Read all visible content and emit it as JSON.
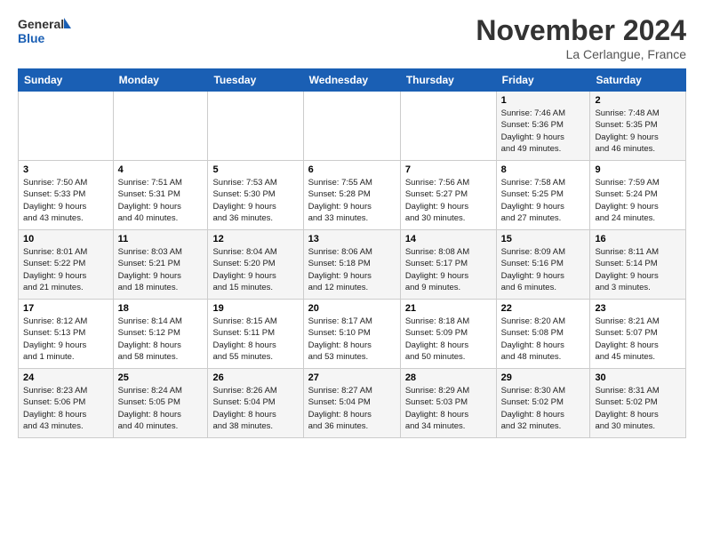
{
  "logo": {
    "line1": "General",
    "line2": "Blue"
  },
  "title": "November 2024",
  "location": "La Cerlangue, France",
  "weekdays": [
    "Sunday",
    "Monday",
    "Tuesday",
    "Wednesday",
    "Thursday",
    "Friday",
    "Saturday"
  ],
  "weeks": [
    [
      {
        "day": "",
        "info": ""
      },
      {
        "day": "",
        "info": ""
      },
      {
        "day": "",
        "info": ""
      },
      {
        "day": "",
        "info": ""
      },
      {
        "day": "",
        "info": ""
      },
      {
        "day": "1",
        "info": "Sunrise: 7:46 AM\nSunset: 5:36 PM\nDaylight: 9 hours\nand 49 minutes."
      },
      {
        "day": "2",
        "info": "Sunrise: 7:48 AM\nSunset: 5:35 PM\nDaylight: 9 hours\nand 46 minutes."
      }
    ],
    [
      {
        "day": "3",
        "info": "Sunrise: 7:50 AM\nSunset: 5:33 PM\nDaylight: 9 hours\nand 43 minutes."
      },
      {
        "day": "4",
        "info": "Sunrise: 7:51 AM\nSunset: 5:31 PM\nDaylight: 9 hours\nand 40 minutes."
      },
      {
        "day": "5",
        "info": "Sunrise: 7:53 AM\nSunset: 5:30 PM\nDaylight: 9 hours\nand 36 minutes."
      },
      {
        "day": "6",
        "info": "Sunrise: 7:55 AM\nSunset: 5:28 PM\nDaylight: 9 hours\nand 33 minutes."
      },
      {
        "day": "7",
        "info": "Sunrise: 7:56 AM\nSunset: 5:27 PM\nDaylight: 9 hours\nand 30 minutes."
      },
      {
        "day": "8",
        "info": "Sunrise: 7:58 AM\nSunset: 5:25 PM\nDaylight: 9 hours\nand 27 minutes."
      },
      {
        "day": "9",
        "info": "Sunrise: 7:59 AM\nSunset: 5:24 PM\nDaylight: 9 hours\nand 24 minutes."
      }
    ],
    [
      {
        "day": "10",
        "info": "Sunrise: 8:01 AM\nSunset: 5:22 PM\nDaylight: 9 hours\nand 21 minutes."
      },
      {
        "day": "11",
        "info": "Sunrise: 8:03 AM\nSunset: 5:21 PM\nDaylight: 9 hours\nand 18 minutes."
      },
      {
        "day": "12",
        "info": "Sunrise: 8:04 AM\nSunset: 5:20 PM\nDaylight: 9 hours\nand 15 minutes."
      },
      {
        "day": "13",
        "info": "Sunrise: 8:06 AM\nSunset: 5:18 PM\nDaylight: 9 hours\nand 12 minutes."
      },
      {
        "day": "14",
        "info": "Sunrise: 8:08 AM\nSunset: 5:17 PM\nDaylight: 9 hours\nand 9 minutes."
      },
      {
        "day": "15",
        "info": "Sunrise: 8:09 AM\nSunset: 5:16 PM\nDaylight: 9 hours\nand 6 minutes."
      },
      {
        "day": "16",
        "info": "Sunrise: 8:11 AM\nSunset: 5:14 PM\nDaylight: 9 hours\nand 3 minutes."
      }
    ],
    [
      {
        "day": "17",
        "info": "Sunrise: 8:12 AM\nSunset: 5:13 PM\nDaylight: 9 hours\nand 1 minute."
      },
      {
        "day": "18",
        "info": "Sunrise: 8:14 AM\nSunset: 5:12 PM\nDaylight: 8 hours\nand 58 minutes."
      },
      {
        "day": "19",
        "info": "Sunrise: 8:15 AM\nSunset: 5:11 PM\nDaylight: 8 hours\nand 55 minutes."
      },
      {
        "day": "20",
        "info": "Sunrise: 8:17 AM\nSunset: 5:10 PM\nDaylight: 8 hours\nand 53 minutes."
      },
      {
        "day": "21",
        "info": "Sunrise: 8:18 AM\nSunset: 5:09 PM\nDaylight: 8 hours\nand 50 minutes."
      },
      {
        "day": "22",
        "info": "Sunrise: 8:20 AM\nSunset: 5:08 PM\nDaylight: 8 hours\nand 48 minutes."
      },
      {
        "day": "23",
        "info": "Sunrise: 8:21 AM\nSunset: 5:07 PM\nDaylight: 8 hours\nand 45 minutes."
      }
    ],
    [
      {
        "day": "24",
        "info": "Sunrise: 8:23 AM\nSunset: 5:06 PM\nDaylight: 8 hours\nand 43 minutes."
      },
      {
        "day": "25",
        "info": "Sunrise: 8:24 AM\nSunset: 5:05 PM\nDaylight: 8 hours\nand 40 minutes."
      },
      {
        "day": "26",
        "info": "Sunrise: 8:26 AM\nSunset: 5:04 PM\nDaylight: 8 hours\nand 38 minutes."
      },
      {
        "day": "27",
        "info": "Sunrise: 8:27 AM\nSunset: 5:04 PM\nDaylight: 8 hours\nand 36 minutes."
      },
      {
        "day": "28",
        "info": "Sunrise: 8:29 AM\nSunset: 5:03 PM\nDaylight: 8 hours\nand 34 minutes."
      },
      {
        "day": "29",
        "info": "Sunrise: 8:30 AM\nSunset: 5:02 PM\nDaylight: 8 hours\nand 32 minutes."
      },
      {
        "day": "30",
        "info": "Sunrise: 8:31 AM\nSunset: 5:02 PM\nDaylight: 8 hours\nand 30 minutes."
      }
    ]
  ]
}
